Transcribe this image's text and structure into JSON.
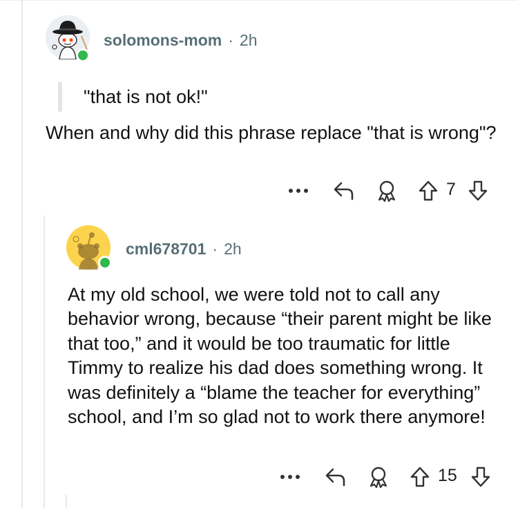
{
  "comment1": {
    "username": "solomons-mom",
    "separator": "·",
    "time": "2h",
    "quote": "\"that is not ok!\"",
    "body": "When and why did this phrase replace \"that is wrong\"?",
    "score": "7",
    "avatar_icon": "snoo-cowboy-hat-avatar",
    "online_color": "#2fb84c"
  },
  "comment2": {
    "username": "cml678701",
    "separator": "·",
    "time": "2h",
    "body": "At my old school, we were told not to call any behavior wrong, because “their parent might be like that too,” and it would be too traumatic for little Timmy to realize his dad does something wrong. It was definitely a “blame the teacher for everything” school, and I’m so glad not to work there anymore!",
    "score": "15",
    "avatar_icon": "snoo-default-avatar",
    "avatar_bg": "#fcd34d",
    "online_color": "#2fb84c"
  },
  "icons": {
    "more": "more-options-icon",
    "reply": "reply-icon",
    "award": "award-icon",
    "upvote": "upvote-icon",
    "downvote": "downvote-icon"
  }
}
